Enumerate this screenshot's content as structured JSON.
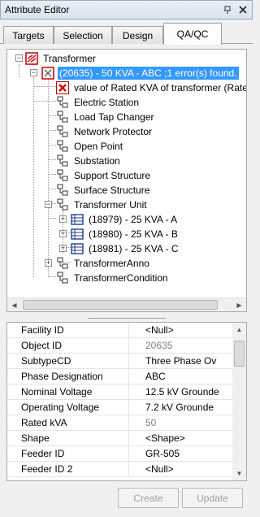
{
  "window": {
    "title": "Attribute Editor",
    "pin_icon": "pin-icon",
    "close_icon": "close-icon"
  },
  "tabs": [
    {
      "label": "Targets",
      "active": false
    },
    {
      "label": "Selection",
      "active": false
    },
    {
      "label": "Design",
      "active": false
    },
    {
      "label": "QA/QC",
      "active": true
    }
  ],
  "tree": {
    "root": {
      "label": "Transformer",
      "icon": "feature-class-icon"
    },
    "selected": {
      "label": "(20635) - 50 KVA - ABC ;1 error(s) found.",
      "icon": "error-feature-icon"
    },
    "error_item": {
      "label": "value of Rated KVA of transformer (Rate",
      "icon": "error-x-icon"
    },
    "relationships": [
      {
        "label": "Electric Station",
        "icon": "relationship-icon"
      },
      {
        "label": "Load Tap Changer",
        "icon": "relationship-icon"
      },
      {
        "label": "Network Protector",
        "icon": "relationship-icon"
      },
      {
        "label": "Open Point",
        "icon": "relationship-icon"
      },
      {
        "label": "Substation",
        "icon": "relationship-icon"
      },
      {
        "label": "Support Structure",
        "icon": "relationship-icon"
      },
      {
        "label": "Surface Structure",
        "icon": "relationship-icon"
      },
      {
        "label": "Transformer Unit",
        "icon": "relationship-icon"
      }
    ],
    "units": [
      {
        "label": "(18979) - 25 KVA - A",
        "icon": "table-row-icon"
      },
      {
        "label": "(18980) - 25 KVA - B",
        "icon": "table-row-icon"
      },
      {
        "label": "(18981) - 25 KVA - C",
        "icon": "table-row-icon"
      }
    ],
    "tail": [
      {
        "label": "TransformerAnno",
        "icon": "relationship-icon"
      },
      {
        "label": "TransformerCondition",
        "icon": "relationship-icon"
      }
    ]
  },
  "properties": [
    {
      "name": "Facility ID",
      "value": "<Null>",
      "readonly": false
    },
    {
      "name": "Object ID",
      "value": "20635",
      "readonly": true
    },
    {
      "name": "SubtypeCD",
      "value": "Three Phase Ov",
      "readonly": false
    },
    {
      "name": "Phase Designation",
      "value": "ABC",
      "readonly": false
    },
    {
      "name": "Nominal Voltage",
      "value": "12.5 kV Grounde",
      "readonly": false
    },
    {
      "name": "Operating Voltage",
      "value": "7.2 kV Grounde",
      "readonly": false
    },
    {
      "name": "Rated kVA",
      "value": "50",
      "readonly": true
    },
    {
      "name": "Shape",
      "value": "<Shape>",
      "readonly": false
    },
    {
      "name": "Feeder ID",
      "value": "GR-505",
      "readonly": false
    },
    {
      "name": "Feeder ID 2",
      "value": "<Null>",
      "readonly": false
    }
  ],
  "buttons": {
    "create": "Create",
    "update": "Update"
  },
  "colors": {
    "selection": "#3399ff",
    "error_red": "#d40000",
    "readonly_text": "#808080"
  }
}
